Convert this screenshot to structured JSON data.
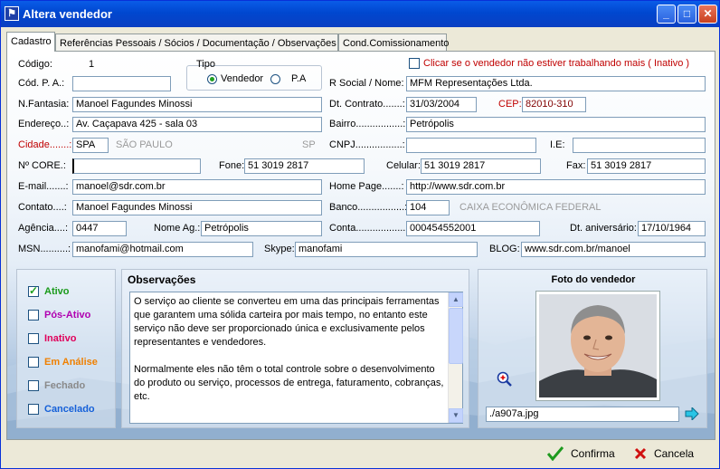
{
  "window": {
    "title": "Altera vendedor",
    "minimize": "_",
    "maximize": "□",
    "close": "✕"
  },
  "tabs": [
    {
      "label": "Cadastro"
    },
    {
      "label": "Referências Pessoais / Sócios / Documentação / Observações"
    },
    {
      "label": "Cond.Comissionamento"
    }
  ],
  "form": {
    "codigo_label": "Código:",
    "codigo_value": "1",
    "tipo_label": "Tipo",
    "tipo_vendedor": "Vendedor",
    "tipo_pa": "P.A",
    "inativo_check_label": "Clicar se o vendedor não estiver trabalhando mais ( Inativo )",
    "cod_pa_label": "Cód. P. A.:",
    "cod_pa_value": "",
    "rsocial_label": "R Social / Nome:",
    "rsocial_value": "MFM Representações Ltda.",
    "fantasia_label": "N.Fantasia:",
    "fantasia_value": "Manoel Fagundes Minossi",
    "dtcontrato_label": "Dt. Contrato.......:",
    "dtcontrato_value": "31/03/2004",
    "cep_label": "CEP:",
    "cep_value": "82010-310",
    "endereco_label": "Endereço..:",
    "endereco_value": "Av. Caçapava 425 - sala 03",
    "bairro_label": "Bairro.................:",
    "bairro_value": "Petrópolis",
    "cidade_label": "Cidade.......:",
    "cidade_code": "SPA",
    "cidade_name": "SÃO PAULO",
    "uf": "SP",
    "cnpj_label": "CNPJ.................:",
    "cnpj_value": "",
    "ie_label": "I.E:",
    "ie_value": "",
    "core_label": "Nº CORE.:",
    "core_value": "",
    "fone_label": "Fone:",
    "fone_value": "51 3019 2817",
    "celular_label": "Celular:",
    "celular_value": "51 3019 2817",
    "fax_label": "Fax:",
    "fax_value": "51 3019 2817",
    "email_label": "E-mail.......:",
    "email_value": "manoel@sdr.com.br",
    "homepage_label": "Home Page.......:",
    "homepage_value": "http://www.sdr.com.br",
    "contato_label": "Contato....:",
    "contato_value": "Manoel Fagundes Minossi",
    "banco_label": "Banco.................:",
    "banco_code": "104",
    "banco_name": "CAIXA ECONÔMICA FEDERAL",
    "agencia_label": "Agência....:",
    "agencia_value": "0447",
    "nomeag_label": "Nome Ag.:",
    "nomeag_value": "Petrópolis",
    "conta_label": "Conta...................:",
    "conta_value": "000454552001",
    "aniversario_label": "Dt. aniversário:",
    "aniversario_value": "17/10/1964",
    "msn_label": "MSN..........:",
    "msn_value": "manofami@hotmail.com",
    "skype_label": "Skype:",
    "skype_value": "manofami",
    "blog_label": "BLOG:",
    "blog_value": "www.sdr.com.br/manoel"
  },
  "status": [
    {
      "label": "Ativo",
      "checked": true,
      "color": "#1a9a1a"
    },
    {
      "label": "Pós-Ativo",
      "checked": false,
      "color": "#b000b0"
    },
    {
      "label": "Inativo",
      "checked": false,
      "color": "#e0005a"
    },
    {
      "label": "Em Análise",
      "checked": false,
      "color": "#f08000"
    },
    {
      "label": "Fechado",
      "checked": false,
      "color": "#8a8a8a"
    },
    {
      "label": "Cancelado",
      "checked": false,
      "color": "#1560d8"
    }
  ],
  "observacoes": {
    "title": "Observações",
    "text": "O serviço ao cliente se converteu em uma das principais ferramentas que garantem uma sólida carteira por mais tempo, no entanto este serviço não deve ser proporcionado única e exclusivamente pelos representantes e vendedores.\n\nNormalmente eles não têm o total controle sobre o desenvolvimento do produto ou serviço, processos de entrega, faturamento, cobranças, etc."
  },
  "foto": {
    "title": "Foto do vendedor",
    "filename": "./a907a.jpg"
  },
  "actions": {
    "confirma": "Confirma",
    "cancela": "Cancela"
  },
  "icons": {
    "confirm": "check-icon",
    "cancel": "x-icon",
    "zoom": "zoom-in-icon",
    "arrow": "arrow-right-icon"
  }
}
